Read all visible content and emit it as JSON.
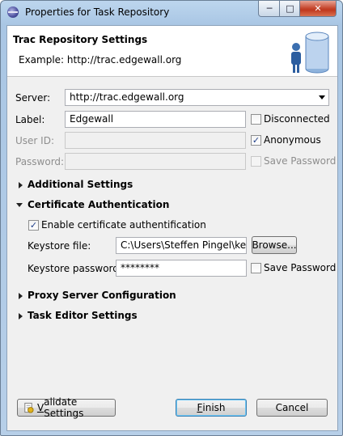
{
  "window": {
    "title": "Properties for Task Repository"
  },
  "header": {
    "title": "Trac Repository Settings",
    "description": "Example: http://trac.edgewall.org"
  },
  "form": {
    "server": {
      "label": "Server:",
      "value": "http://trac.edgewall.org"
    },
    "label": {
      "label": "Label:",
      "value": "Edgewall"
    },
    "user_id": {
      "label": "User ID:",
      "value": ""
    },
    "password": {
      "label": "Password:",
      "value": ""
    },
    "disconnected": {
      "label": "Disconnected",
      "checked": false
    },
    "anonymous": {
      "label": "Anonymous",
      "checked": true
    },
    "save_password": {
      "label": "Save Password",
      "checked": false
    }
  },
  "sections": {
    "additional": "Additional Settings",
    "certificate": "Certificate Authentication",
    "proxy": "Proxy Server Configuration",
    "task_editor": "Task Editor Settings"
  },
  "certificate": {
    "enable_label": "Enable certificate authentification",
    "enable_checked": true,
    "keystore_file_label": "Keystore file:",
    "keystore_file_value": "C:\\Users\\Steffen Pingel\\keyst",
    "browse_label": "Browse...",
    "keystore_password_label": "Keystore password:",
    "keystore_password_value": "********",
    "save_password_label": "Save Password",
    "save_password_checked": false
  },
  "buttons": {
    "validate_prefix": "",
    "validate_mnemonic": "V",
    "validate_rest": "alidate Settings",
    "finish_mnemonic": "F",
    "finish_rest": "inish",
    "cancel": "Cancel"
  },
  "icons": {
    "app": "eclipse-icon",
    "wizard": "repository-user-icon",
    "validate": "validate-icon"
  }
}
